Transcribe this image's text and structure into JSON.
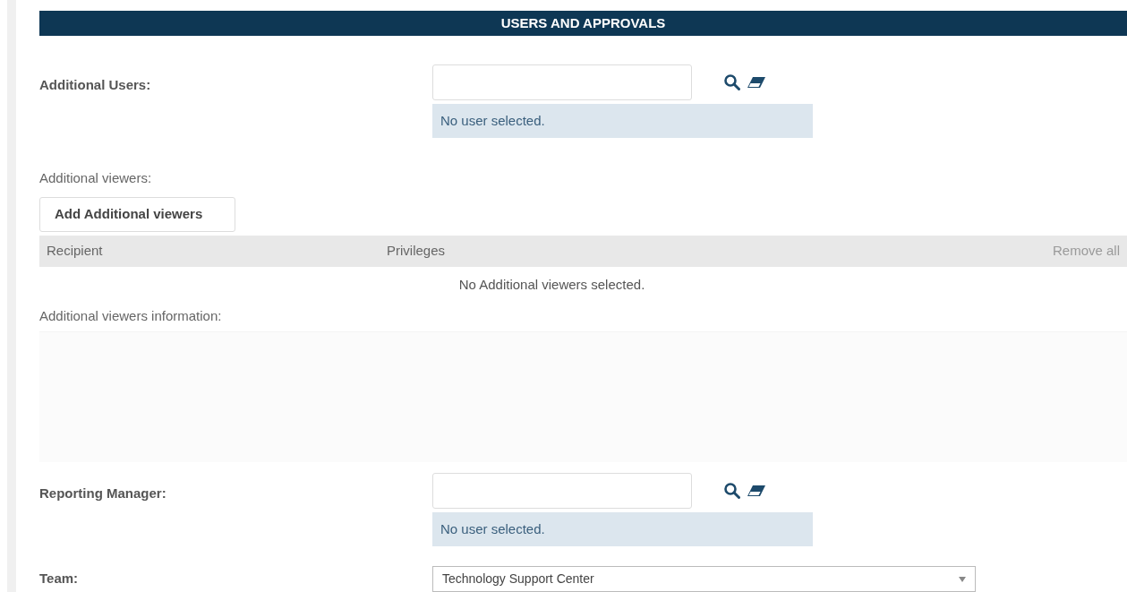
{
  "section_title": "USERS AND APPROVALS",
  "additional_users": {
    "label": "Additional Users:",
    "status": "No user selected."
  },
  "additional_viewers": {
    "label": "Additional viewers:",
    "add_button": "Add Additional viewers",
    "columns": [
      "Recipient",
      "Privileges"
    ],
    "remove_all": {
      "label": "Remove all",
      "disabled": true
    },
    "empty_message": "No Additional viewers selected."
  },
  "viewers_information": {
    "label": "Additional viewers information:"
  },
  "reporting_manager": {
    "label": "Reporting Manager:",
    "status": "No user selected."
  },
  "team": {
    "label": "Team:",
    "value": "Technology Support Center"
  }
}
